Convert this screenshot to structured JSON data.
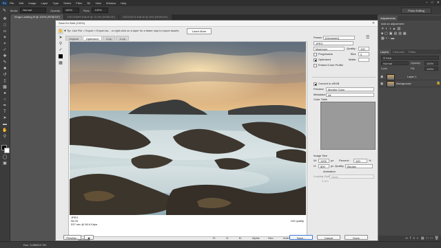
{
  "menubar": {
    "logo": "Ps",
    "items": [
      "File",
      "Edit",
      "Image",
      "Layer",
      "Type",
      "Select",
      "Filter",
      "3D",
      "View",
      "Window",
      "Help"
    ]
  },
  "optionsbar": {
    "mode_label": "Mode:",
    "mode_value": "Normal",
    "opacity_label": "Opacity:",
    "opacity_value": "100%",
    "flow_label": "Flow:",
    "flow_value": "100%",
    "workspace": "Photo Editing"
  },
  "doc_tabs": [
    "Kinga Landing.tif @ 100% (RGB/16*)",
    "DSC00699 Edit.tif @ 12.5% (RGB/16*)",
    "DSC00074 Edit.tif @ 25% (RGB/16*)"
  ],
  "right_dock": {
    "adjustments_tab": "Adjustments",
    "add_adjustment": "Add an adjustment",
    "layers_tabs": [
      "Layers",
      "Channels",
      "Paths"
    ],
    "kind_label": "Kind",
    "blend_mode": "Normal",
    "opacity_label": "Opacity:",
    "opacity_value": "100%",
    "lock_label": "Lock:",
    "fill_label": "Fill:",
    "fill_value": "100%",
    "layers": [
      {
        "name": "Layer 1",
        "selected": false
      },
      {
        "name": "Background",
        "selected": false,
        "italic": true
      }
    ]
  },
  "statusbar": {
    "doc": "Doc: 3.49M/12.7M"
  },
  "dialog": {
    "title": "Save for Web (100%)",
    "tip": "Tip: Use File > Export > Export As... or right click on a layer for a faster way to export assets",
    "learn_more": "Learn More",
    "view_tabs": [
      {
        "label": "Original",
        "active": false
      },
      {
        "label": "Optimized",
        "active": true
      },
      {
        "label": "2-Up",
        "active": false
      },
      {
        "label": "4-Up",
        "active": false
      }
    ],
    "image_info": {
      "format": "JPEG",
      "size": "98.2K",
      "time": "537 sec @ 56.6 Kbps",
      "quality": "100 quality"
    },
    "settings": {
      "preset_label": "Preset:",
      "preset_value": "[Unnamed]",
      "format_value": "JPEG",
      "compression_value": "Maximum",
      "quality_label": "Quality:",
      "quality_value": "100",
      "progressive_label": "Progressive",
      "progressive_checked": false,
      "blur_label": "Blur:",
      "blur_value": "0",
      "optimized_label": "Optimized",
      "optimized_checked": true,
      "matte_label": "Matte:",
      "embed_label": "Embed Color Profile",
      "embed_checked": false,
      "convert_label": "Convert to sRGB",
      "convert_checked": true,
      "preview_label": "Preview:",
      "preview_value": "Monitor Color",
      "metadata_label": "Metadata:",
      "metadata_value": "All",
      "color_table_label": "Color Table",
      "image_size_label": "Image Size",
      "w_label": "W:",
      "w_value": "1200",
      "h_label": "H:",
      "h_value": "800",
      "px_unit": "px",
      "percent_label": "Percent:",
      "percent_value": "100",
      "percent_unit": "%",
      "quality2_label": "Quality:",
      "quality2_value": "Bicubic",
      "animation_label": "Animation",
      "looping_label": "Looping Options:",
      "looping_value": "Once",
      "frame_counter": "1 of 1"
    },
    "bottom": {
      "zoom_value": "100%",
      "r_label": "R:",
      "g_label": "G:",
      "b_label": "B:",
      "alpha_label": "Alpha:",
      "hex_label": "Hex:",
      "index_label": "Index:",
      "preview_btn": "Preview...",
      "save_btn": "Save...",
      "cancel_btn": "Cancel",
      "done_btn": "Done"
    }
  }
}
